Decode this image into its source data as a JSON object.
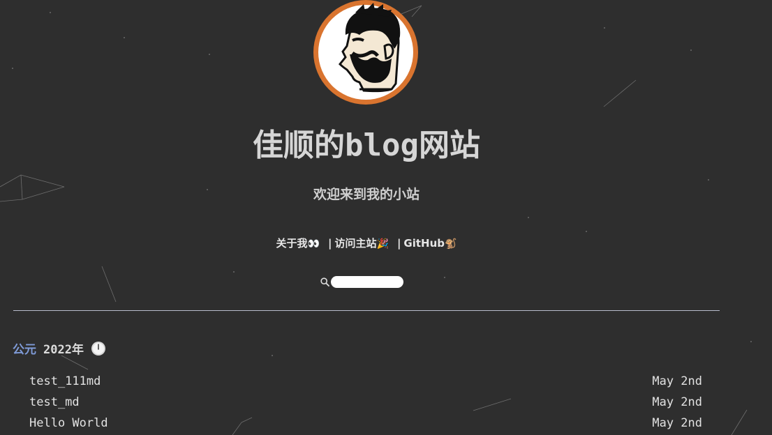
{
  "site": {
    "title": "佳顺的blog网站",
    "subtitle": "欢迎来到我的小站"
  },
  "nav": {
    "about_label": "关于我",
    "about_emoji": "👀",
    "separator": "|",
    "visit_label": "访问主站",
    "visit_emoji": "🎉",
    "github_label": "GitHub",
    "github_emoji": "🐒"
  },
  "search": {
    "value": "",
    "icon": "search-icon"
  },
  "archive": {
    "era": "公元",
    "year": "2022年",
    "year_icon": "clock-icon",
    "posts": [
      {
        "title": "test_111md",
        "date": "May 2nd"
      },
      {
        "title": "test_md",
        "date": "May 2nd"
      },
      {
        "title": "Hello World",
        "date": "May 2nd"
      }
    ]
  },
  "colors": {
    "background": "#2e2e2e",
    "avatar_ring": "#d9742f",
    "era_accent": "#7f9bd8"
  }
}
